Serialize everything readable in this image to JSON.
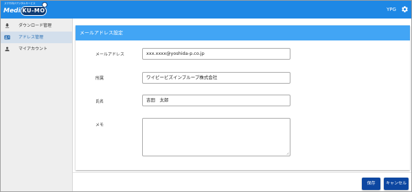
{
  "app": {
    "logo_tagline": "スマホ向けデジタルサービス",
    "logo_media": "Media",
    "logo_kumo": "KU-MO",
    "user_name": "YPG"
  },
  "sidebar": {
    "items": [
      {
        "label": "ダウンロード管理",
        "icon": "download-icon",
        "active": false
      },
      {
        "label": "アドレス管理",
        "icon": "address-card-icon",
        "active": true
      },
      {
        "label": "マイアカウント",
        "icon": "person-icon",
        "active": false
      }
    ]
  },
  "form": {
    "title": "メールアドレス設定",
    "fields": [
      {
        "label": "メールアドレス",
        "value": "xxx.xxxx@yoshida-p.co.jp"
      },
      {
        "label": "所属",
        "value": "ワイピービズインプループ株式会社"
      },
      {
        "label": "氏名",
        "value": "吉田　太郎"
      },
      {
        "label": "メモ",
        "value": ""
      }
    ]
  },
  "actions": {
    "save_label": "保存",
    "cancel_label": "キャンセル"
  },
  "colors": {
    "header": "#1e88e5",
    "card_header": "#42a5f5",
    "button": "#0d47a1",
    "sidebar_active": "#d3dfec"
  }
}
